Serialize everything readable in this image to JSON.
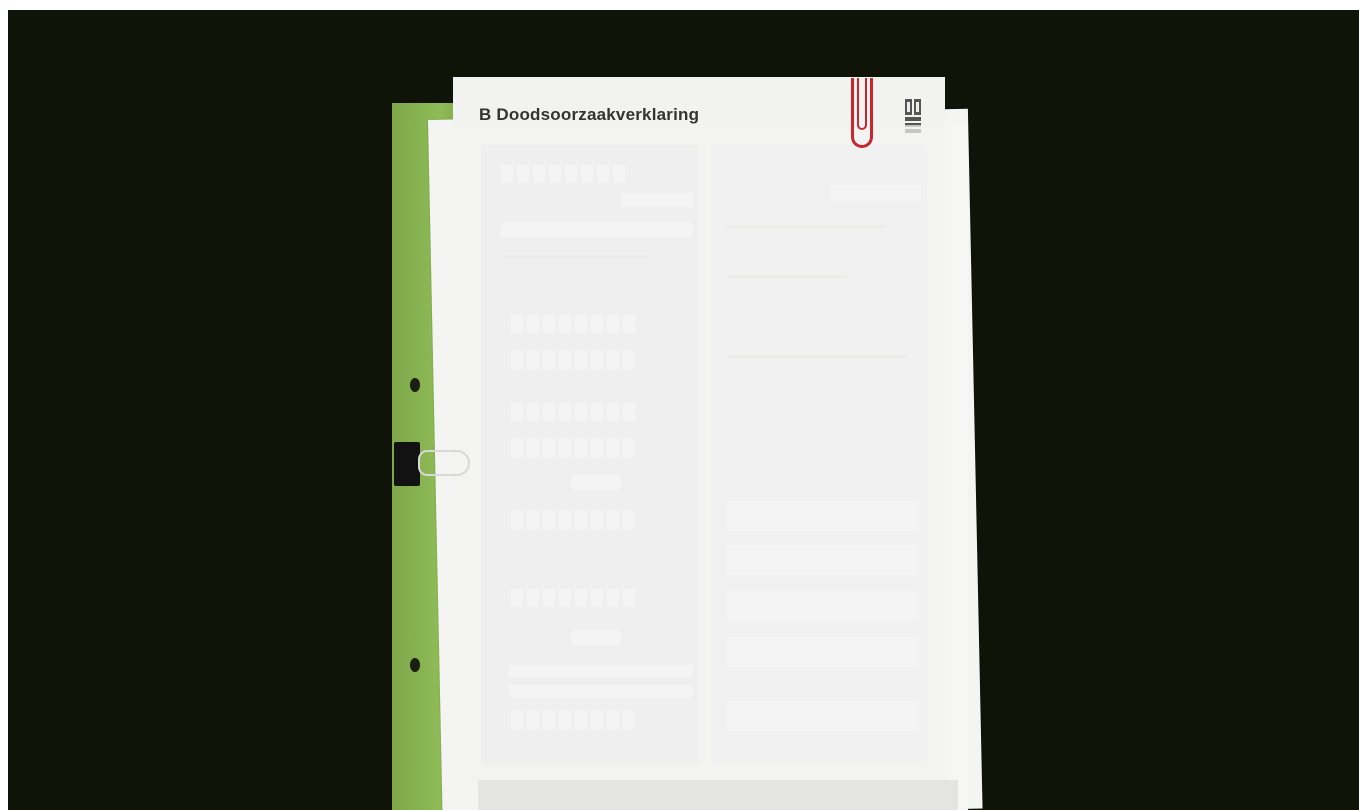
{
  "document": {
    "title_visible": "B  Doodsoorzaakverklaring",
    "title_faded_suffix": "",
    "logo_icon": "ministry-logo-icon",
    "paperclip_color": "#c9262f",
    "folder_color": "#8fbb57",
    "background_color": "#0f1308"
  }
}
